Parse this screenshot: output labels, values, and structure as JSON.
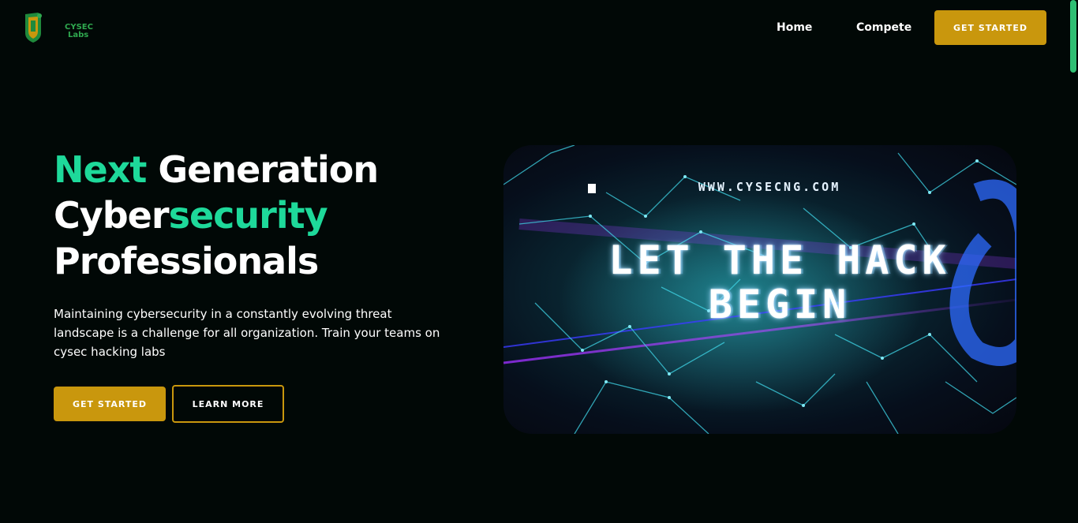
{
  "brand": {
    "logo_text_line1": "CYSEC",
    "logo_text_line2": "Labs"
  },
  "nav": {
    "home": "Home",
    "compete": "Compete",
    "cta": "GET STARTED"
  },
  "hero": {
    "title_part1": "Next",
    "title_part2": " Generation",
    "title_part3": "Cyber",
    "title_part4": "security",
    "title_part5": "Professionals",
    "description": "Maintaining cybersecurity in a constantly evolving threat landscape is a challenge for all organization. Train your teams on cysec hacking labs",
    "primary_button": "GET STARTED",
    "secondary_button": "LEARN MORE"
  },
  "banner": {
    "url": "WWW.CYSECNG.COM",
    "headline_line1": "LET THE HACK",
    "headline_line2": "BEGIN"
  },
  "colors": {
    "background": "#010806",
    "accent_green": "#1ed99a",
    "gold": "#c9970d",
    "logo_green": "#2fa84f"
  }
}
